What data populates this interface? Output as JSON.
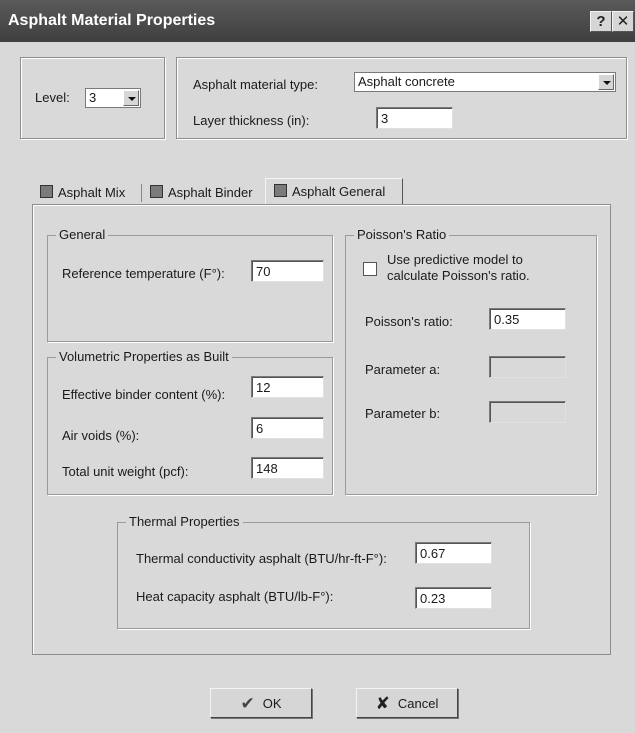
{
  "window": {
    "title": "Asphalt Material Properties",
    "help_label": "?",
    "close_label": "✕"
  },
  "level": {
    "label": "Level:",
    "value": "3"
  },
  "material": {
    "type_label": "Asphalt material type:",
    "type_value": "Asphalt concrete",
    "thickness_label": "Layer thickness (in):",
    "thickness_value": "3"
  },
  "tabs": [
    {
      "label": "Asphalt Mix",
      "active": false
    },
    {
      "label": "Asphalt Binder",
      "active": false
    },
    {
      "label": "Asphalt General",
      "active": true
    }
  ],
  "general": {
    "title": "General",
    "ref_temp_label": "Reference temperature (F°):",
    "ref_temp_value": "70"
  },
  "volumetric": {
    "title": "Volumetric Properties as Built",
    "binder_label": "Effective binder content (%):",
    "binder_value": "12",
    "air_label": "Air voids (%):",
    "air_value": "6",
    "weight_label": "Total unit weight (pcf):",
    "weight_value": "148"
  },
  "poisson": {
    "title": "Poisson's Ratio",
    "predictive_label_1": "Use predictive model to",
    "predictive_label_2": "calculate Poisson's ratio.",
    "predictive_checked": false,
    "ratio_label": "Poisson's ratio:",
    "ratio_value": "0.35",
    "param_a_label": "Parameter a:",
    "param_a_value": "",
    "param_b_label": "Parameter b:",
    "param_b_value": ""
  },
  "thermal": {
    "title": "Thermal Properties",
    "conductivity_label": "Thermal conductivity asphalt (BTU/hr-ft-F°):",
    "conductivity_value": "0.67",
    "capacity_label": "Heat capacity asphalt (BTU/lb-F°):",
    "capacity_value": "0.23"
  },
  "buttons": {
    "ok_label": "OK",
    "ok_icon": "✔",
    "cancel_label": "Cancel",
    "cancel_icon": "✘"
  }
}
